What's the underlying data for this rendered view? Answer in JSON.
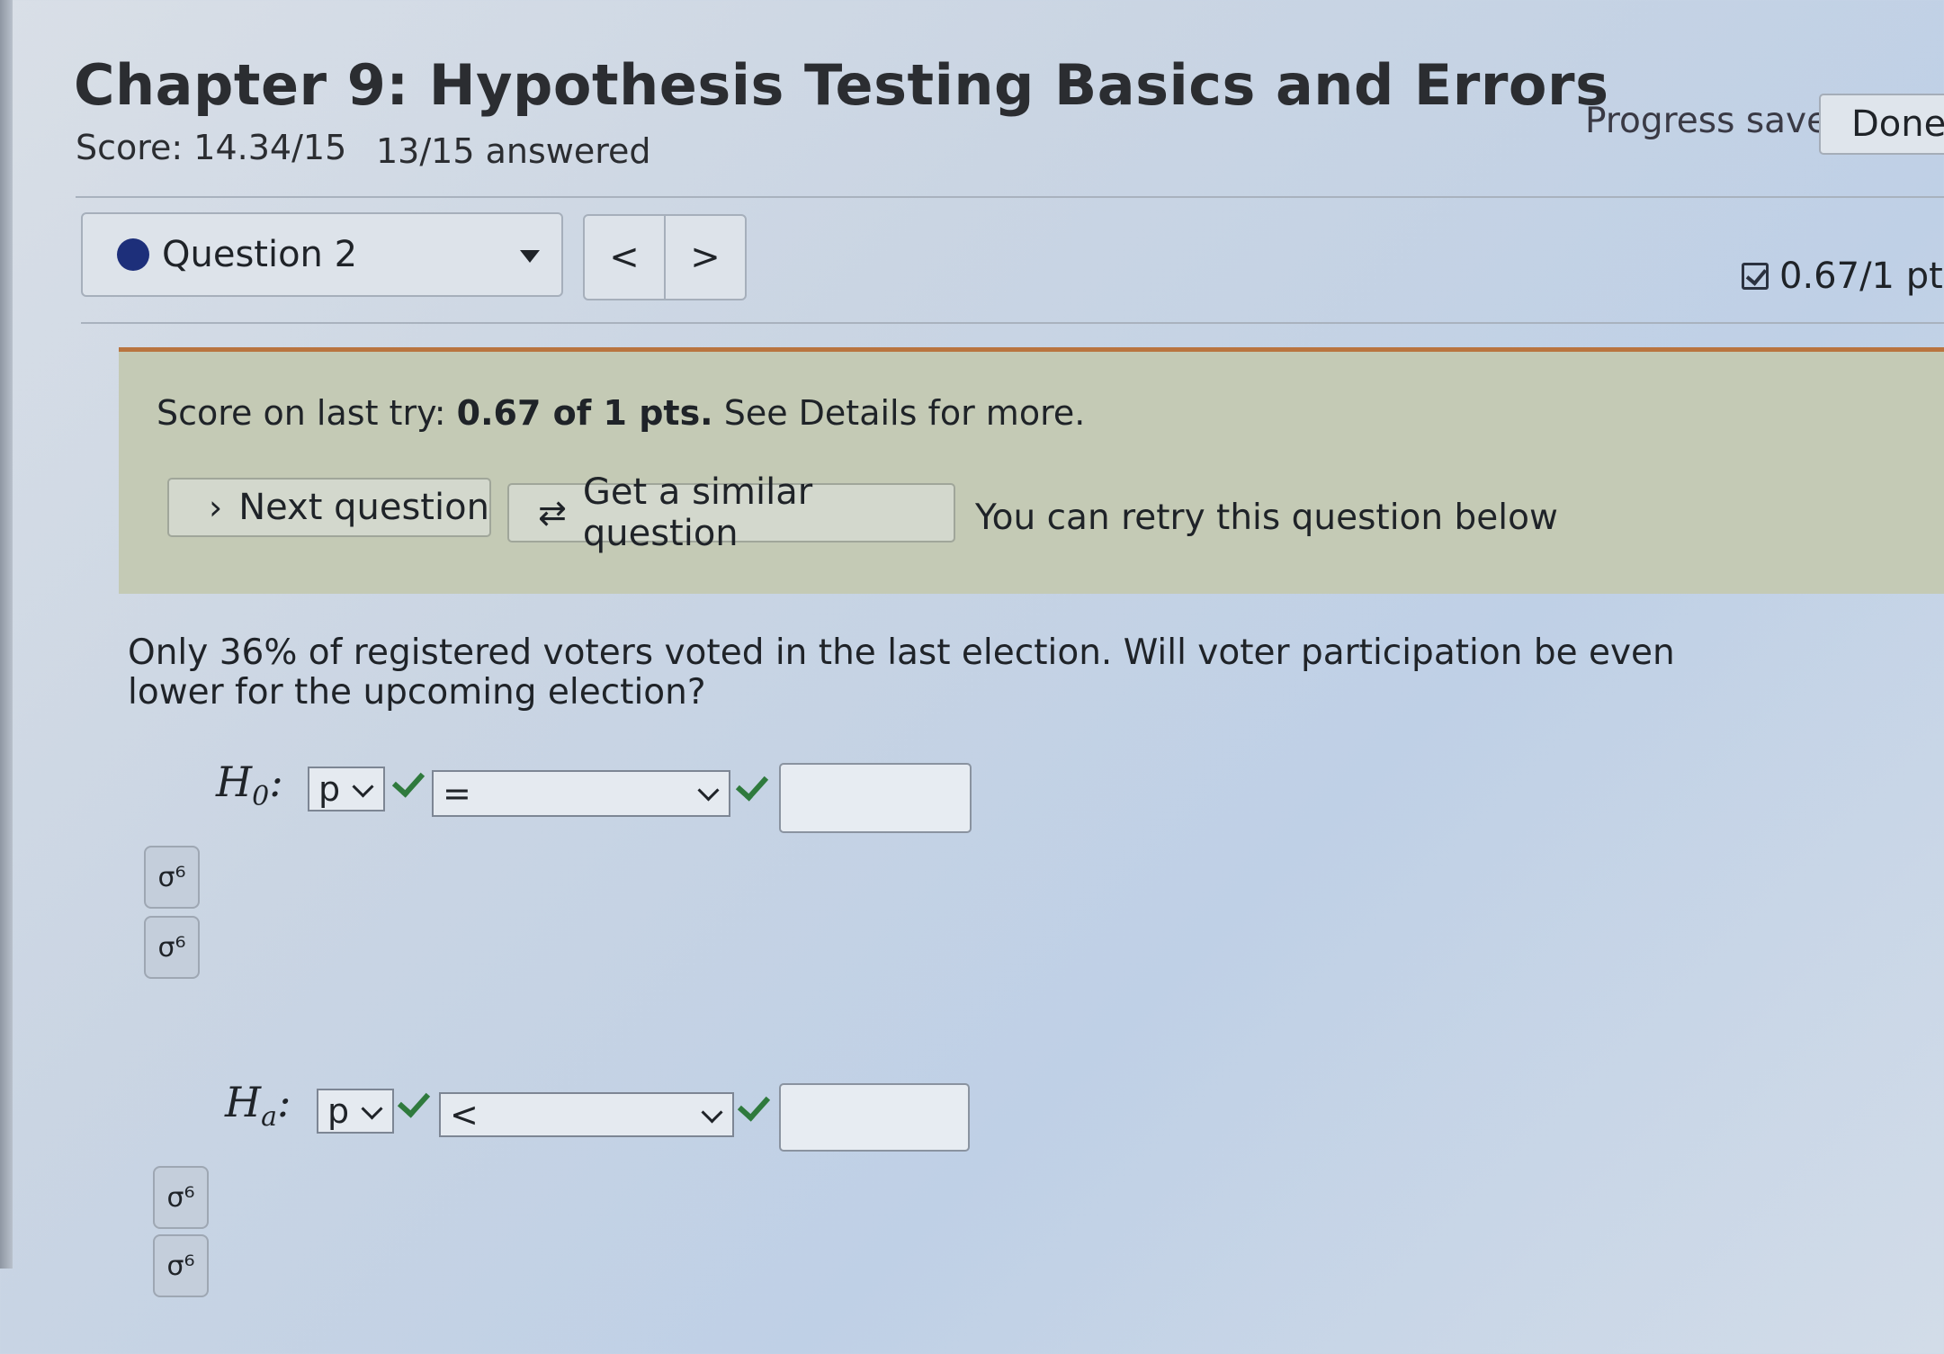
{
  "header": {
    "title": "Chapter 9: Hypothesis Testing Basics and Errors",
    "score": "Score: 14.34/15",
    "answered": "13/15 answered",
    "progress_status": "Progress saved",
    "done_label": "Done"
  },
  "question_nav": {
    "selected_question": "Question 2",
    "prev_label": "<",
    "next_label": ">",
    "points": "0.67/1 pt"
  },
  "banner": {
    "score_prefix": "Score on last try: ",
    "score_bold": "0.67 of 1 pts.",
    "score_suffix": " See Details for more.",
    "next_question_label": "Next question",
    "similar_question_label": "Get a similar question",
    "retry_text": "You can retry this question below"
  },
  "question": {
    "text": "Only 36% of registered voters voted in the last election. Will voter participation be even lower for the upcoming election?"
  },
  "null_hypothesis": {
    "label": "H",
    "subscript": "0",
    "colon": ":",
    "parameter": "p",
    "operator": "=",
    "value": ""
  },
  "alt_hypothesis": {
    "label": "H",
    "subscript": "a",
    "colon": ":",
    "parameter": "p",
    "operator": "<",
    "value": ""
  },
  "symbol_buttons": {
    "symbol": "σ⁶"
  },
  "colors": {
    "banner_bg": "#c4cab5",
    "banner_border": "#b9743f",
    "check_green": "#2f7a3d",
    "question_dot": "#1d2f7a"
  }
}
